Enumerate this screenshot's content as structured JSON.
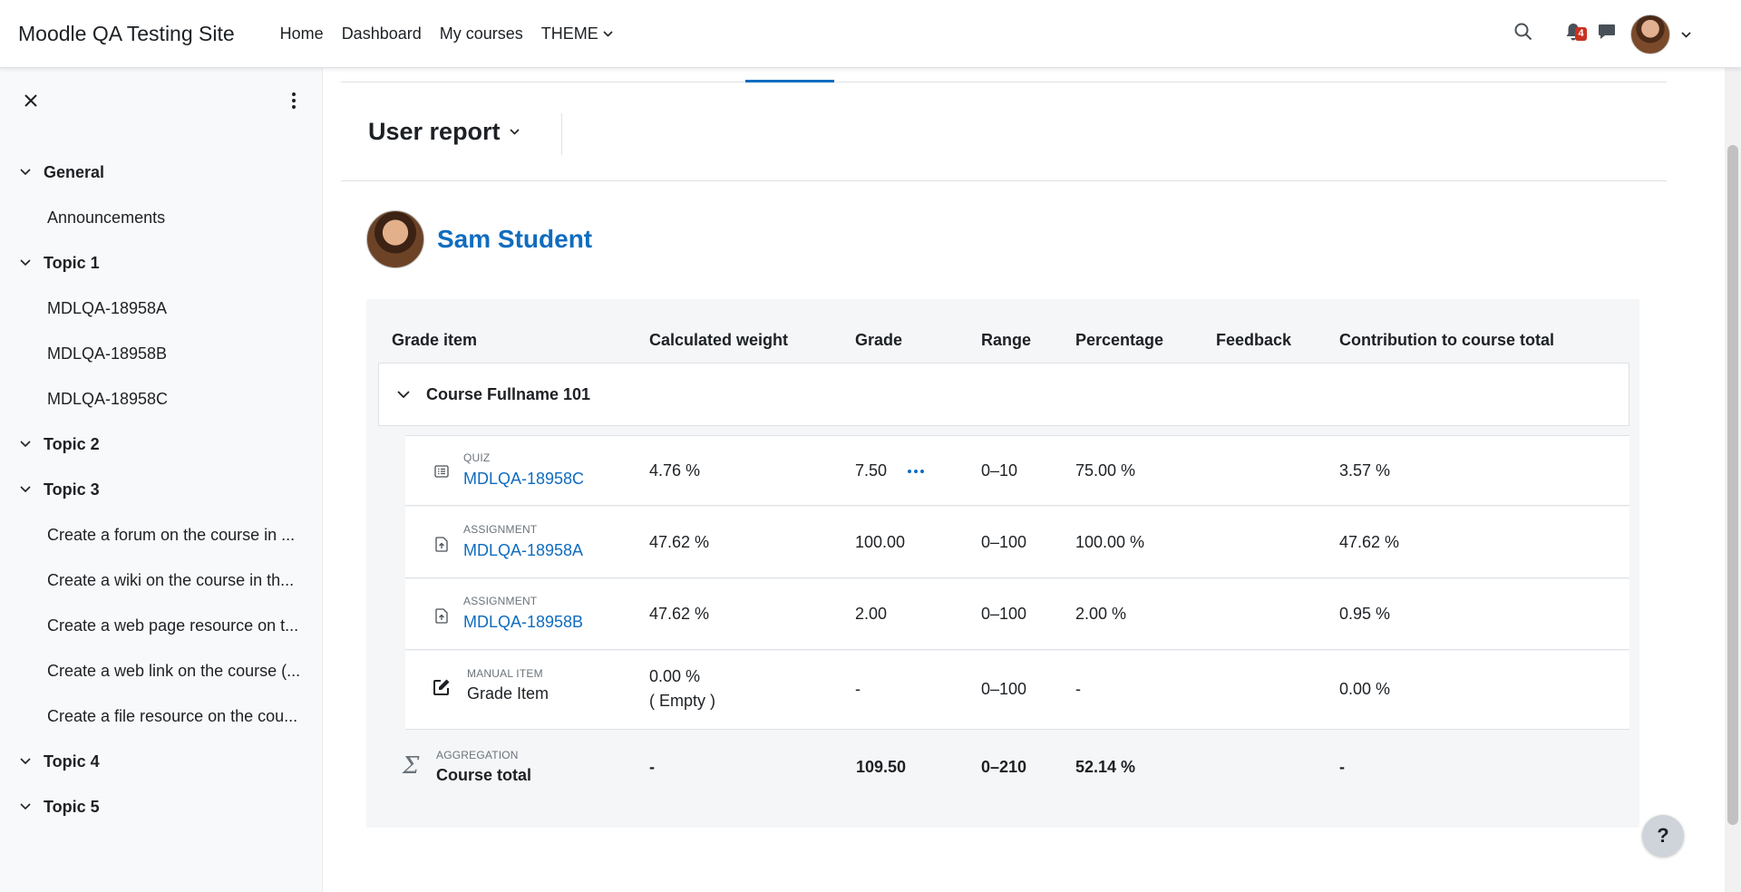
{
  "site": {
    "name": "Moodle QA Testing Site"
  },
  "nav": {
    "links": [
      "Home",
      "Dashboard",
      "My courses",
      "THEME"
    ],
    "notifications_count": "4"
  },
  "drawer": {
    "sections": [
      {
        "title": "General",
        "items": [
          "Announcements"
        ]
      },
      {
        "title": "Topic 1",
        "items": [
          "MDLQA-18958A",
          "MDLQA-18958B",
          "MDLQA-18958C"
        ]
      },
      {
        "title": "Topic 2",
        "items": []
      },
      {
        "title": "Topic 3",
        "items": [
          "Create a forum on the course in ...",
          "Create a wiki on the course in th...",
          "Create a web page resource on t...",
          "Create a web link on the course (...",
          "Create a file resource on the cou..."
        ]
      },
      {
        "title": "Topic 4",
        "items": []
      },
      {
        "title": "Topic 5",
        "items": []
      }
    ]
  },
  "report": {
    "title": "User report",
    "user_name": "Sam Student"
  },
  "table": {
    "headers": [
      "Grade item",
      "Calculated weight",
      "Grade",
      "Range",
      "Percentage",
      "Feedback",
      "Contribution to course total"
    ],
    "category": "Course Fullname 101",
    "rows": [
      {
        "type": "QUIZ",
        "name": "MDLQA-18958C",
        "weight": "4.76 %",
        "grade": "7.50",
        "range": "0–10",
        "percentage": "75.00 %",
        "feedback": "",
        "contribution": "3.57 %",
        "icon": "quiz-icon"
      },
      {
        "type": "ASSIGNMENT",
        "name": "MDLQA-18958A",
        "weight": "47.62 %",
        "grade": "100.00",
        "range": "0–100",
        "percentage": "100.00 %",
        "feedback": "",
        "contribution": "47.62 %",
        "icon": "assignment-icon"
      },
      {
        "type": "ASSIGNMENT",
        "name": "MDLQA-18958B",
        "weight": "47.62 %",
        "grade": "2.00",
        "range": "0–100",
        "percentage": "2.00 %",
        "feedback": "",
        "contribution": "0.95 %",
        "icon": "assignment-icon"
      },
      {
        "type": "MANUAL ITEM",
        "name": "Grade Item",
        "weight": "0.00 %",
        "weight_note": "( Empty )",
        "grade": "-",
        "range": "0–100",
        "percentage": "-",
        "feedback": "",
        "contribution": "0.00 %",
        "icon": "edit-icon"
      }
    ],
    "total": {
      "type": "AGGREGATION",
      "name": "Course total",
      "weight": "-",
      "grade": "109.50",
      "range": "0–210",
      "percentage": "52.14 %",
      "feedback": "",
      "contribution": "-",
      "icon": "sigma-icon"
    }
  },
  "help": {
    "label": "?"
  },
  "colors": {
    "link": "#0f6cbf",
    "badge": "#ca3120",
    "panel_bg": "#f5f6f7"
  }
}
